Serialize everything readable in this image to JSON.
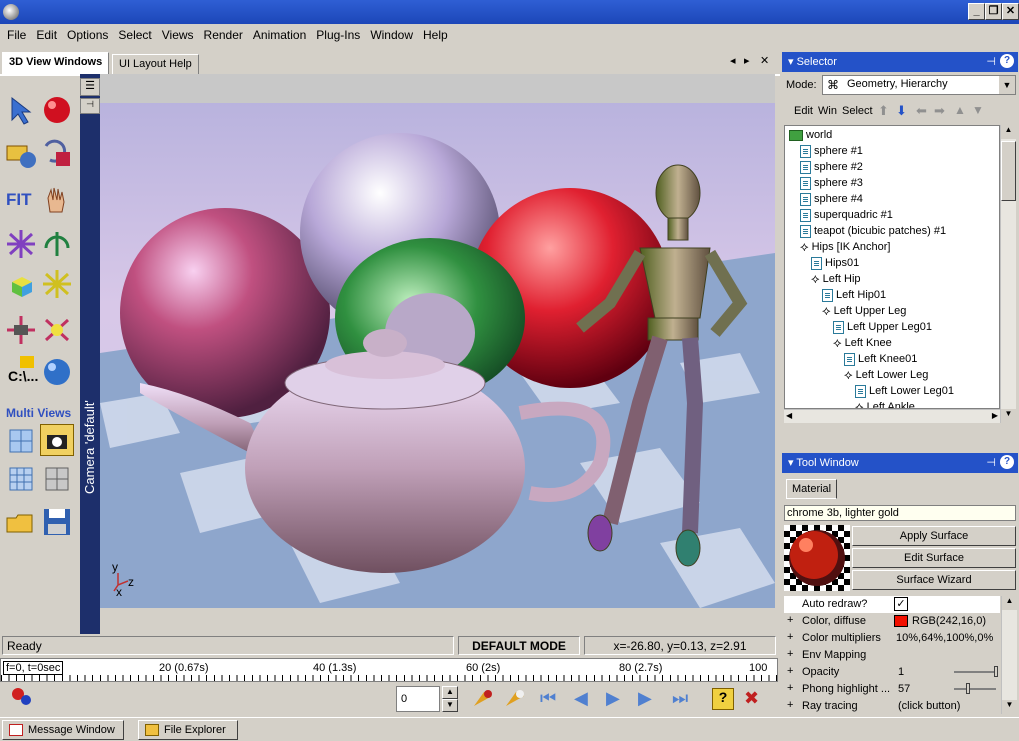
{
  "menu": [
    "File",
    "Edit",
    "Options",
    "Select",
    "Views",
    "Render",
    "Animation",
    "Plug-Ins",
    "Window",
    "Help"
  ],
  "tabs": {
    "active": "3D View Windows",
    "other": "UI Layout Help"
  },
  "tools": {
    "fit_label": "FIT",
    "cl_label": "C:\\...",
    "multi_views_label": "Multi Views"
  },
  "camera_label": "Camera 'default'",
  "axes": {
    "y": "y",
    "z": "z",
    "x": "x"
  },
  "status": {
    "ready": "Ready",
    "mode": "DEFAULT MODE",
    "coords": "x=-26.80, y=0.13, z=2.91"
  },
  "timeline": {
    "labels": [
      "f=0, t=0sec",
      "20 (0.67s)",
      "40 (1.3s)",
      "60 (2s)",
      "80 (2.7s)",
      "100"
    ]
  },
  "frame_value": "0",
  "selector": {
    "title": "Selector",
    "mode_label": "Mode:",
    "mode_value": "Geometry, Hierarchy",
    "menu": [
      "Edit",
      "Win",
      "Select"
    ],
    "tree": [
      {
        "label": "world",
        "depth": 0,
        "icon": "folder"
      },
      {
        "label": "sphere #1",
        "depth": 1,
        "icon": "doc"
      },
      {
        "label": "sphere #2",
        "depth": 1,
        "icon": "doc"
      },
      {
        "label": "sphere #3",
        "depth": 1,
        "icon": "doc"
      },
      {
        "label": "sphere #4",
        "depth": 1,
        "icon": "doc"
      },
      {
        "label": "superquadric #1",
        "depth": 1,
        "icon": "doc"
      },
      {
        "label": "teapot (bicubic patches) #1",
        "depth": 1,
        "icon": "doc"
      },
      {
        "label": "Hips [IK Anchor]",
        "depth": 1,
        "icon": "bone"
      },
      {
        "label": "Hips01",
        "depth": 2,
        "icon": "doc"
      },
      {
        "label": "Left Hip",
        "depth": 2,
        "icon": "bone"
      },
      {
        "label": "Left Hip01",
        "depth": 3,
        "icon": "doc"
      },
      {
        "label": "Left Upper Leg",
        "depth": 3,
        "icon": "bone"
      },
      {
        "label": "Left Upper Leg01",
        "depth": 4,
        "icon": "doc"
      },
      {
        "label": "Left Knee",
        "depth": 4,
        "icon": "bone"
      },
      {
        "label": "Left Knee01",
        "depth": 5,
        "icon": "doc"
      },
      {
        "label": "Left Lower Leg",
        "depth": 5,
        "icon": "bone"
      },
      {
        "label": "Left Lower Leg01",
        "depth": 6,
        "icon": "doc"
      },
      {
        "label": "Left Ankle",
        "depth": 6,
        "icon": "bone"
      }
    ]
  },
  "tool_window": {
    "title": "Tool Window",
    "tab": "Material",
    "material_name": "chrome 3b, lighter gold",
    "buttons": [
      "Apply Surface",
      "Edit Surface",
      "Surface Wizard"
    ],
    "props": [
      {
        "name": "Auto redraw?",
        "value": "✓",
        "color": ""
      },
      {
        "name": "Color, diffuse",
        "value": "RGB(242,16,0)",
        "color": "#f21000"
      },
      {
        "name": "Color multipliers",
        "value": "10%,64%,100%,0%",
        "color": ""
      },
      {
        "name": "Env Mapping",
        "value": "",
        "color": ""
      },
      {
        "name": "Opacity",
        "value": "1",
        "color": ""
      },
      {
        "name": "Phong highlight ...",
        "value": "57",
        "color": ""
      },
      {
        "name": "Ray tracing",
        "value": "(click button)",
        "color": ""
      }
    ]
  },
  "taskbar": [
    "Message Window",
    "File Explorer"
  ],
  "colors": {
    "accent": "#2452c8",
    "title": "#1c46b8"
  }
}
